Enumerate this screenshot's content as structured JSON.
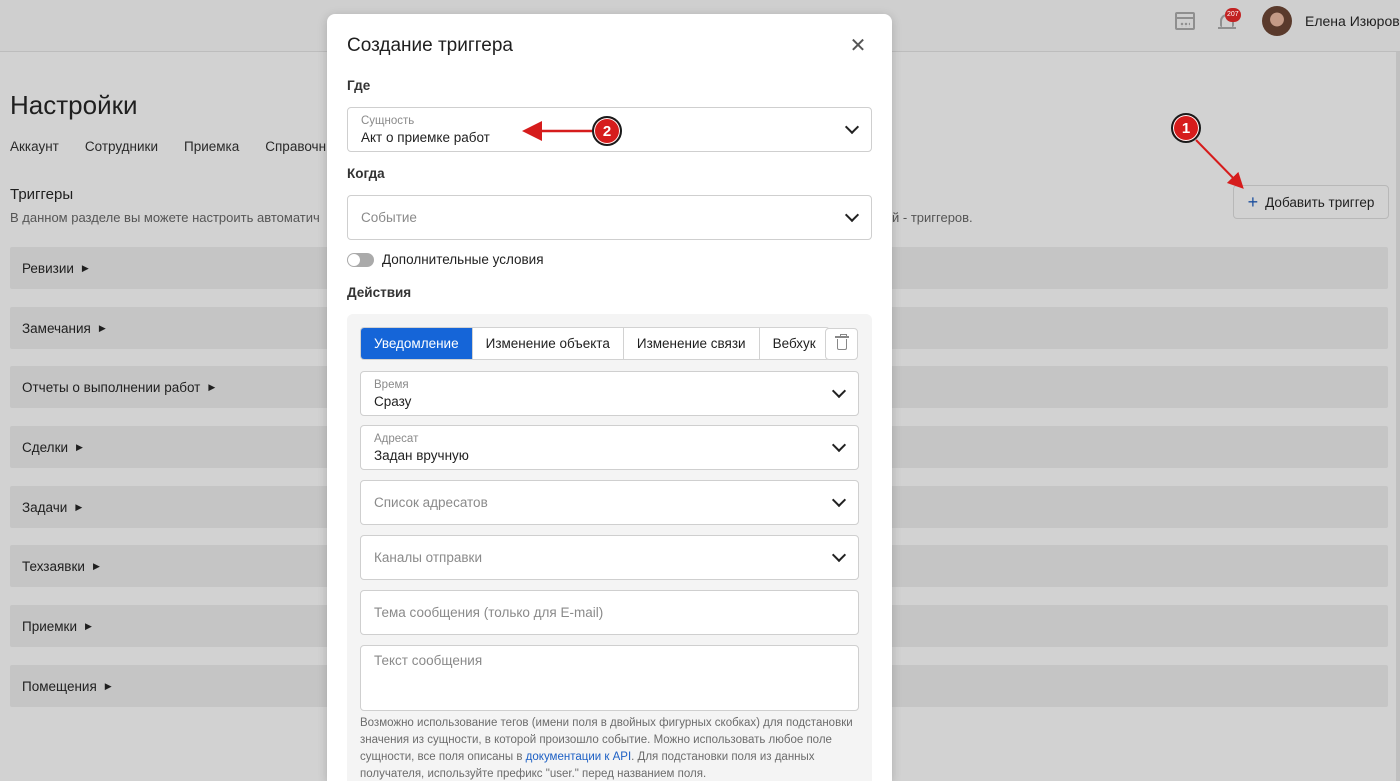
{
  "header": {
    "user_name": "Елена Изюрова",
    "notifications_count": "207"
  },
  "page": {
    "title": "Настройки",
    "tabs": [
      "Аккаунт",
      "Сотрудники",
      "Приемка",
      "Справочн"
    ],
    "section_title": "Триггеры",
    "section_desc_left": "В данном разделе вы можете настроить автоматич",
    "section_desc_right": "й - триггеров.",
    "add_trigger_label": "Добавить триггер",
    "groups": [
      "Ревизии",
      "Замечания",
      "Отчеты о выполнении работ",
      "Сделки",
      "Задачи",
      "Техзаявки",
      "Приемки",
      "Помещения"
    ]
  },
  "annotations": {
    "badge_1": "1",
    "badge_2": "2",
    "color": "#d61c1c"
  },
  "modal": {
    "title": "Создание триггера",
    "where_label": "Где",
    "entity": {
      "label": "Сущность",
      "value": "Акт о приемке работ"
    },
    "when_label": "Когда",
    "event_placeholder": "Событие",
    "extra_conditions_label": "Дополнительные условия",
    "extra_conditions_on": false,
    "actions_label": "Действия",
    "action_tabs": [
      "Уведомление",
      "Изменение объекта",
      "Изменение связи",
      "Вебхук"
    ],
    "active_action_tab": "Уведомление",
    "time": {
      "label": "Время",
      "value": "Сразу"
    },
    "recipient": {
      "label": "Адресат",
      "value": "Задан вручную"
    },
    "recipients_list_placeholder": "Список адресатов",
    "channels_placeholder": "Каналы отправки",
    "subject_placeholder": "Тема сообщения (только для E-mail)",
    "message_placeholder": "Текст сообщения",
    "hint_part1": "Возможно использование тегов (имени поля в двойных фигурных скобках) для подстановки значения из сущности, в которой произошло событие. Можно использовать любое поле сущности, все поля описаны в ",
    "hint_link": "документации к API",
    "hint_part2": ". Для подстановки поля из данных получателя, используйте префикс \"user.\" перед названием поля."
  },
  "colors": {
    "accent": "#1565d8",
    "overlay_bg": "#d2d2d2"
  }
}
